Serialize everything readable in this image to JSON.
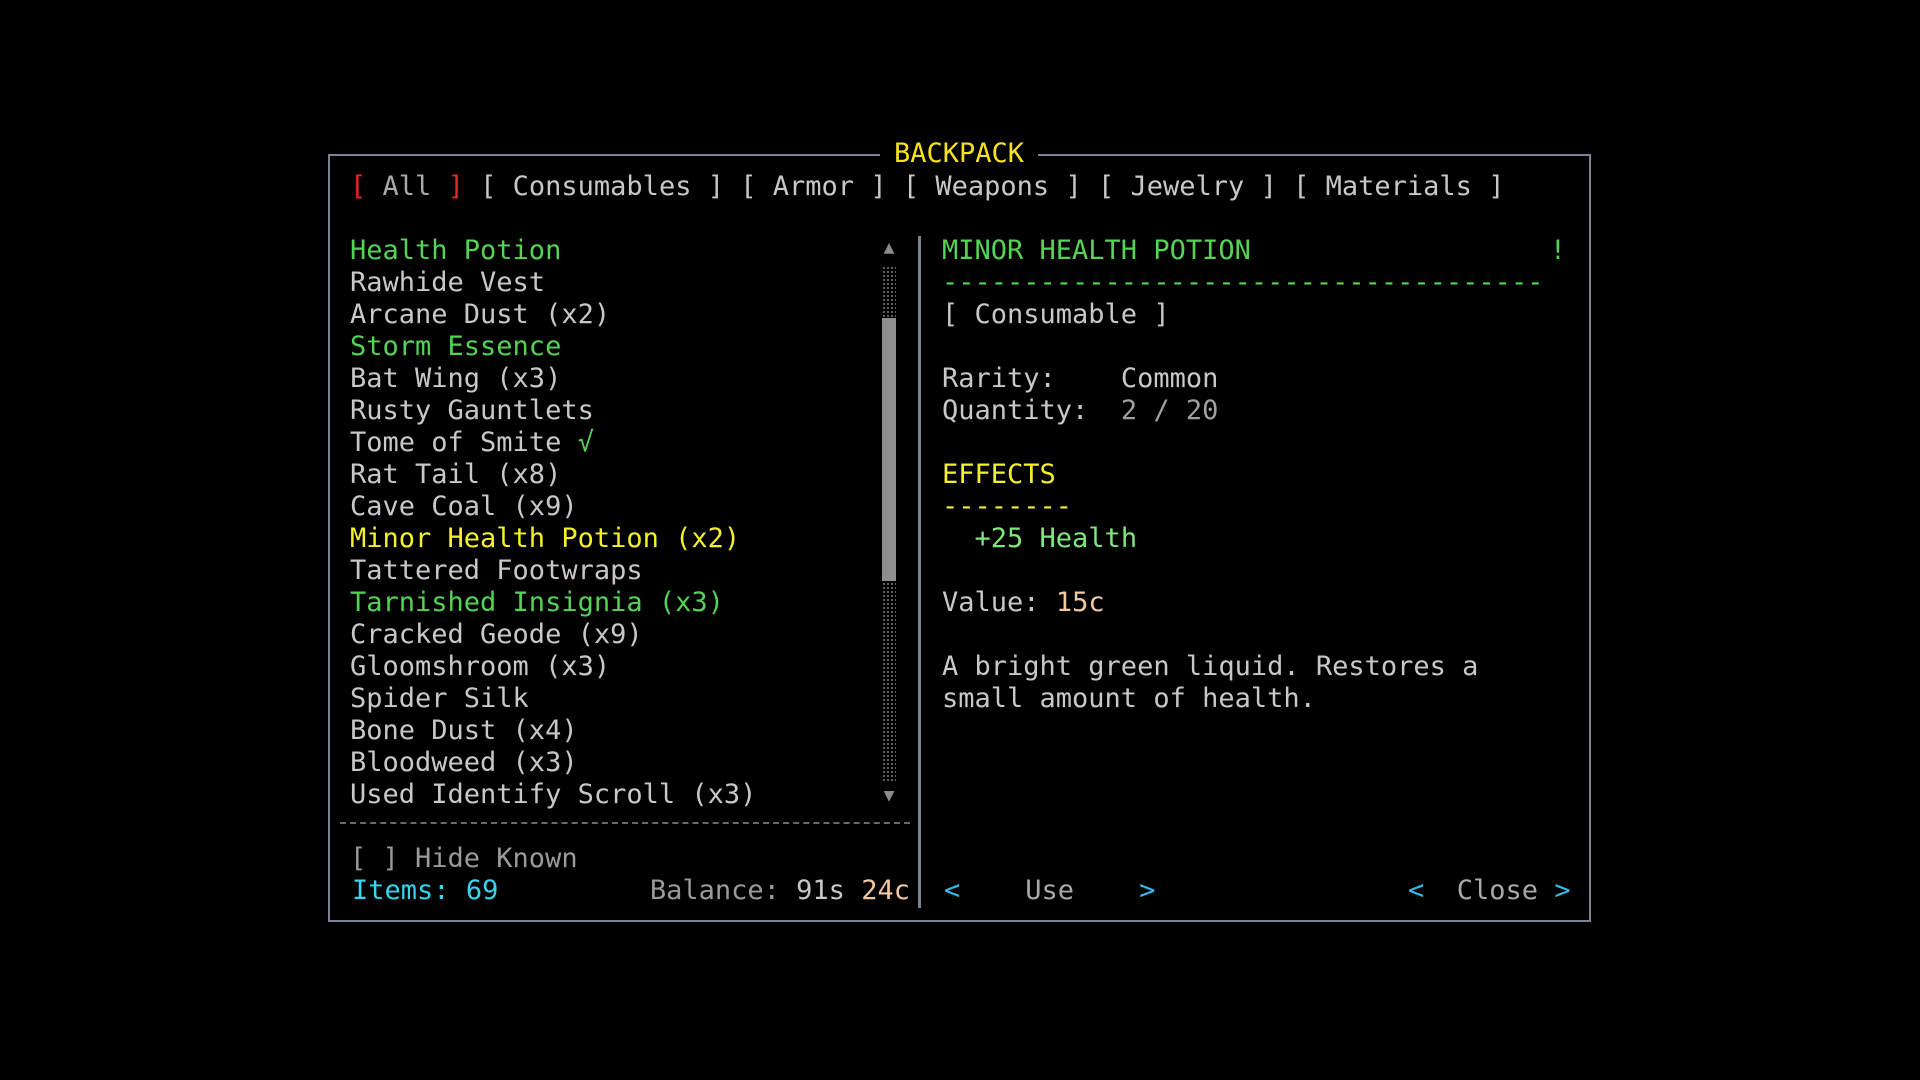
{
  "window": {
    "title": "BACKPACK"
  },
  "tabs": [
    {
      "label": "All",
      "active": true
    },
    {
      "label": "Consumables",
      "active": false
    },
    {
      "label": "Armor",
      "active": false
    },
    {
      "label": "Weapons",
      "active": false
    },
    {
      "label": "Jewelry",
      "active": false
    },
    {
      "label": "Materials",
      "active": false
    }
  ],
  "tab_brackets": {
    "open": "[",
    "close": "]"
  },
  "items": [
    {
      "label": "Health Potion",
      "color": "green"
    },
    {
      "label": "Rawhide Vest",
      "color": "default"
    },
    {
      "label": "Arcane Dust (x2)",
      "color": "default"
    },
    {
      "label": "Storm Essence",
      "color": "green"
    },
    {
      "label": "Bat Wing (x3)",
      "color": "default"
    },
    {
      "label": "Rusty Gauntlets",
      "color": "default"
    },
    {
      "label": "Tome of Smite",
      "color": "default",
      "mark": "√"
    },
    {
      "label": "Rat Tail (x8)",
      "color": "default"
    },
    {
      "label": "Cave Coal (x9)",
      "color": "default"
    },
    {
      "label": "Minor Health Potion (x2)",
      "color": "yellow",
      "selected": true
    },
    {
      "label": "Tattered Footwraps",
      "color": "default"
    },
    {
      "label": "Tarnished Insignia (x3)",
      "color": "green"
    },
    {
      "label": "Cracked Geode (x9)",
      "color": "default"
    },
    {
      "label": "Gloomshroom (x3)",
      "color": "default"
    },
    {
      "label": "Spider Silk",
      "color": "default"
    },
    {
      "label": "Bone Dust (x4)",
      "color": "default"
    },
    {
      "label": "Bloodweed (x3)",
      "color": "default"
    },
    {
      "label": "Used Identify Scroll (x3)",
      "color": "default"
    }
  ],
  "scroll": {
    "up_arrow": "▲",
    "down_arrow": "▼",
    "thumb_start": 0.1,
    "thumb_fraction": 0.51
  },
  "filter": {
    "hide_known": "[ ] Hide Known"
  },
  "footer": {
    "items_label": "Items:",
    "items_count": "69",
    "balance_label": "Balance:",
    "balance_silver": "91s",
    "balance_copper": "24c"
  },
  "detail": {
    "name": "MINOR HEALTH POTION",
    "flag": "!",
    "divider": "-------------------------------------",
    "category": "[ Consumable ]",
    "rarity_label": "Rarity:",
    "rarity_value": "Common",
    "quantity_label": "Quantity:",
    "quantity_value": "2 / 20",
    "effects_title": "EFFECTS",
    "effects_divider": "--------",
    "effects": [
      "+25 Health"
    ],
    "value_label": "Value:",
    "value_amount": "15c",
    "description_lines": [
      "A bright green liquid. Restores a",
      "small amount of health."
    ]
  },
  "actions": {
    "prev_arrow": "<",
    "next_arrow": ">",
    "use_label": "Use",
    "close_label": "Close"
  },
  "colors": {
    "border": "#7c8392",
    "title": "#f5e11e",
    "green": "#54d354",
    "yellow": "#f5f02c",
    "cyan": "#36d4ee",
    "active_bracket": "#e02a2a",
    "copper": "#f2c8a0"
  }
}
